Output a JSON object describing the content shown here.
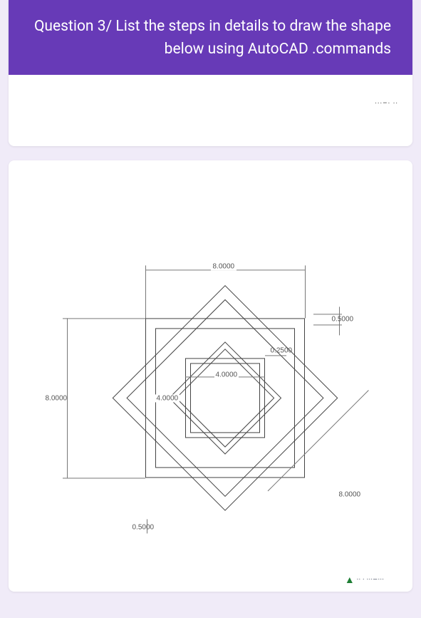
{
  "question": {
    "text": "Question 3/ List the steps in details to draw the shape below using AutoCAD .commands"
  },
  "body_scribble": "···–·   ··",
  "dimensions": {
    "outer_square_top": "8.0000",
    "offset_top_right": "0.5000",
    "fillet_inner": "0.2500",
    "mid_square_top": "4.0000",
    "left_height": "8.0000",
    "mid_left": "4.0000",
    "lower_right_diag": "8.0000",
    "lower_offset": "0.5000"
  },
  "footer_text": "···–··· · ··",
  "chart_data": {
    "type": "diagram",
    "description": "AutoCAD technical drawing: star-of-Lakshmi style pattern made of four concentric axis-aligned squares interleaved with four concentric 45°-rotated squares, with linear dimensions.",
    "squares_axis_aligned": [
      8.0,
      7.0,
      4.0,
      3.5
    ],
    "squares_rotated_45": [
      8.0,
      7.0,
      4.0,
      3.5
    ],
    "offset_between_pairs": 0.5,
    "inner_fillet_radius": 0.25,
    "units": "unitless (AutoCAD drawing units)"
  }
}
